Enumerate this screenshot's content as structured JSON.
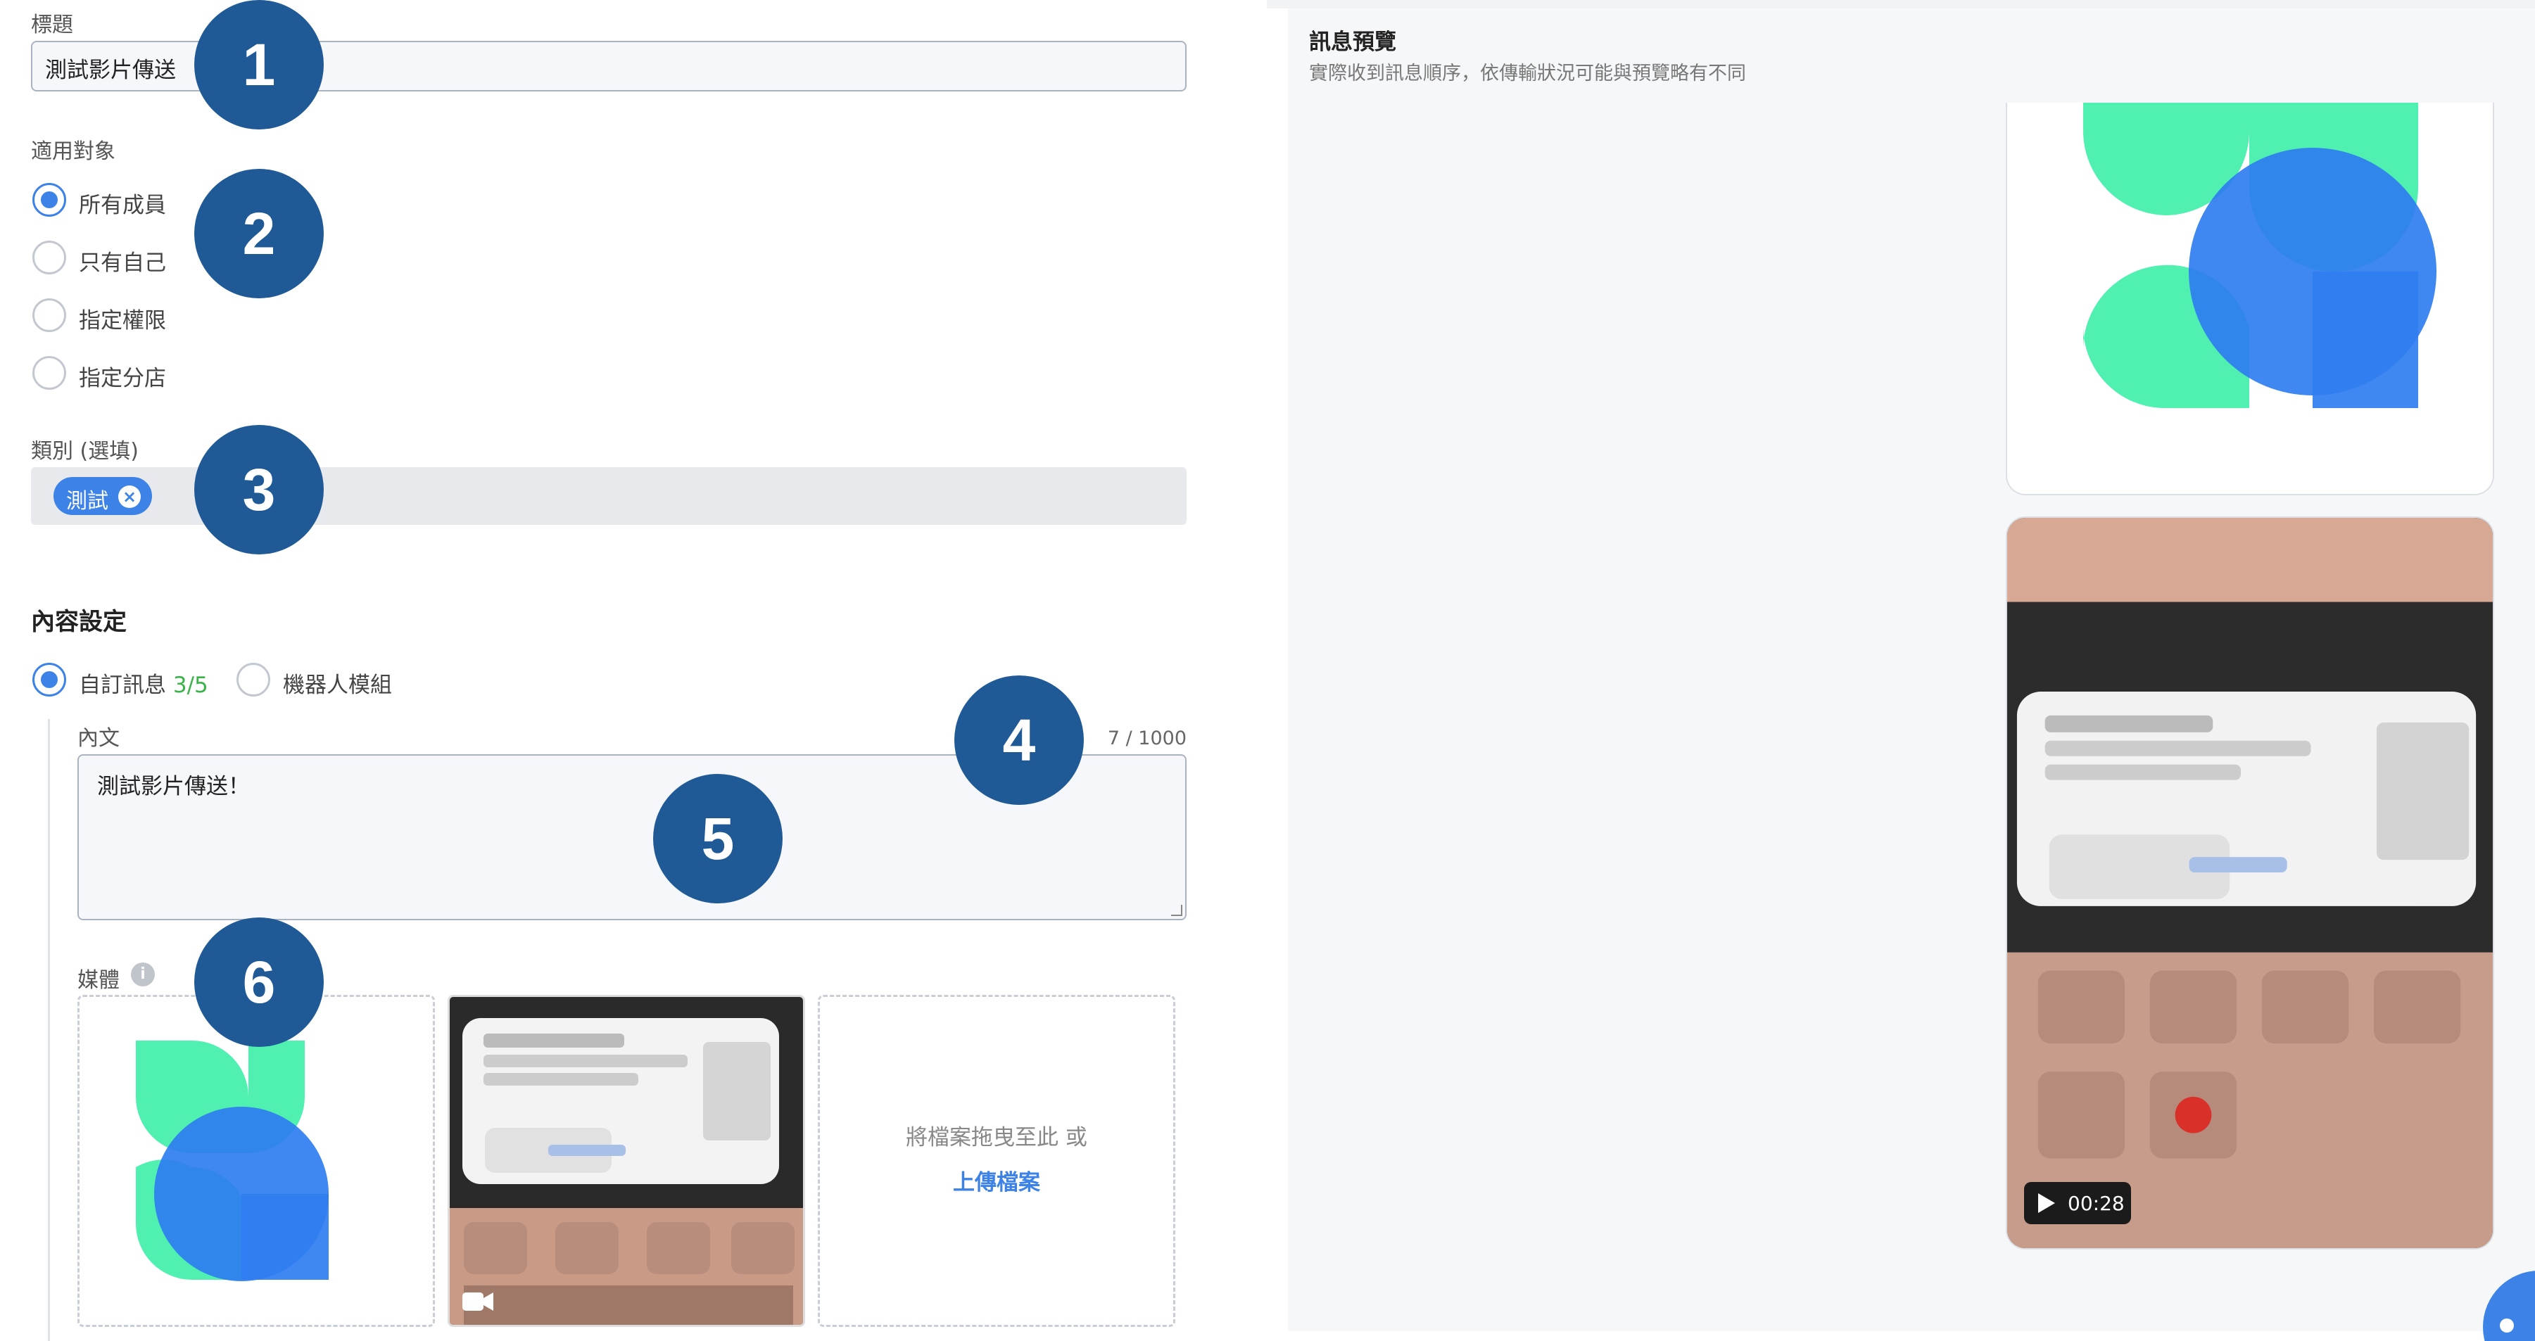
{
  "form": {
    "title_label": "標題",
    "title_value": "測試影片傳送",
    "audience_label": "適用對象",
    "audience_options": [
      "所有成員",
      "只有自己",
      "指定權限",
      "指定分店"
    ],
    "audience_selected": "所有成員",
    "category_label": "類別 (選填)",
    "category_tags": [
      "測試"
    ],
    "content_section_title": "內容設定",
    "content_modes": [
      "自訂訊息",
      "機器人模組"
    ],
    "content_mode_counter": "3/5",
    "body_label": "內文",
    "body_counter": "7 / 1000",
    "body_value": "測試影片傳送！",
    "media_label": "媒體",
    "upload_hint": "將檔案拖曳至此 或",
    "upload_link": "上傳檔案"
  },
  "preview": {
    "title": "訊息預覽",
    "subtitle": "實際收到訊息順序，依傳輸狀況可能與預覽略有不同",
    "video_duration": "00:28"
  },
  "annotations": [
    "1",
    "2",
    "3",
    "4",
    "5",
    "6"
  ],
  "colors": {
    "accent": "#3d82e6",
    "badge": "#1f5a96",
    "logo_green": "#4ff0b0",
    "logo_blue": "#2f7df0"
  }
}
